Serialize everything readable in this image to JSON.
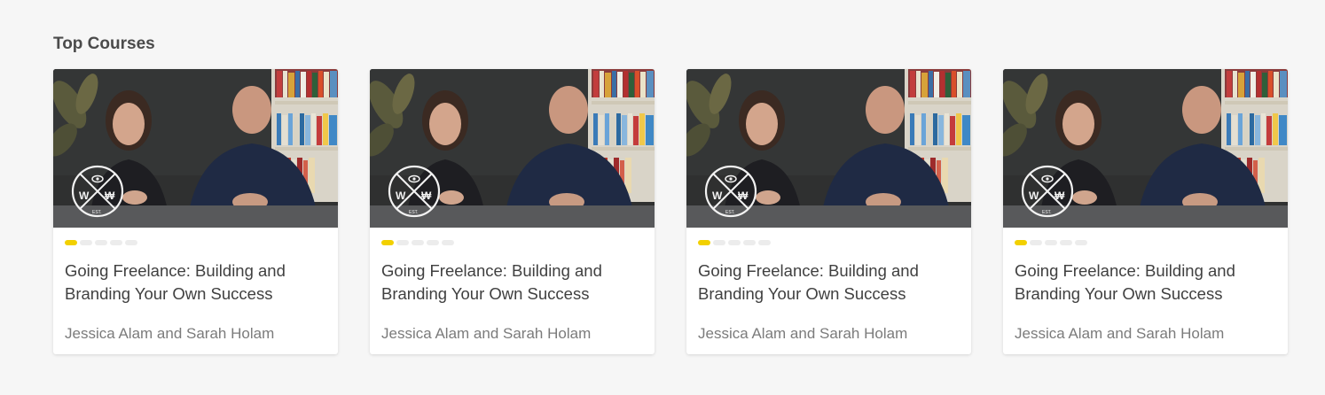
{
  "section": {
    "title": "Top Courses"
  },
  "colors": {
    "progress_filled": "#f2d000",
    "progress_empty": "#ececec"
  },
  "courses": [
    {
      "title": "Going Freelance: Building and Branding Your Own Success",
      "authors": "Jessica Alam and Sarah Holam",
      "progress_total": 5,
      "progress_done": 1
    },
    {
      "title": "Going Freelance: Building and Branding Your Own Success",
      "authors": "Jessica Alam and Sarah Holam",
      "progress_total": 5,
      "progress_done": 1
    },
    {
      "title": "Going Freelance: Building and Branding Your Own Success",
      "authors": "Jessica Alam and Sarah Holam",
      "progress_total": 5,
      "progress_done": 1
    },
    {
      "title": "Going Freelance: Building and Branding Your Own Success",
      "authors": "Jessica Alam and Sarah Holam",
      "progress_total": 5,
      "progress_done": 1
    }
  ]
}
